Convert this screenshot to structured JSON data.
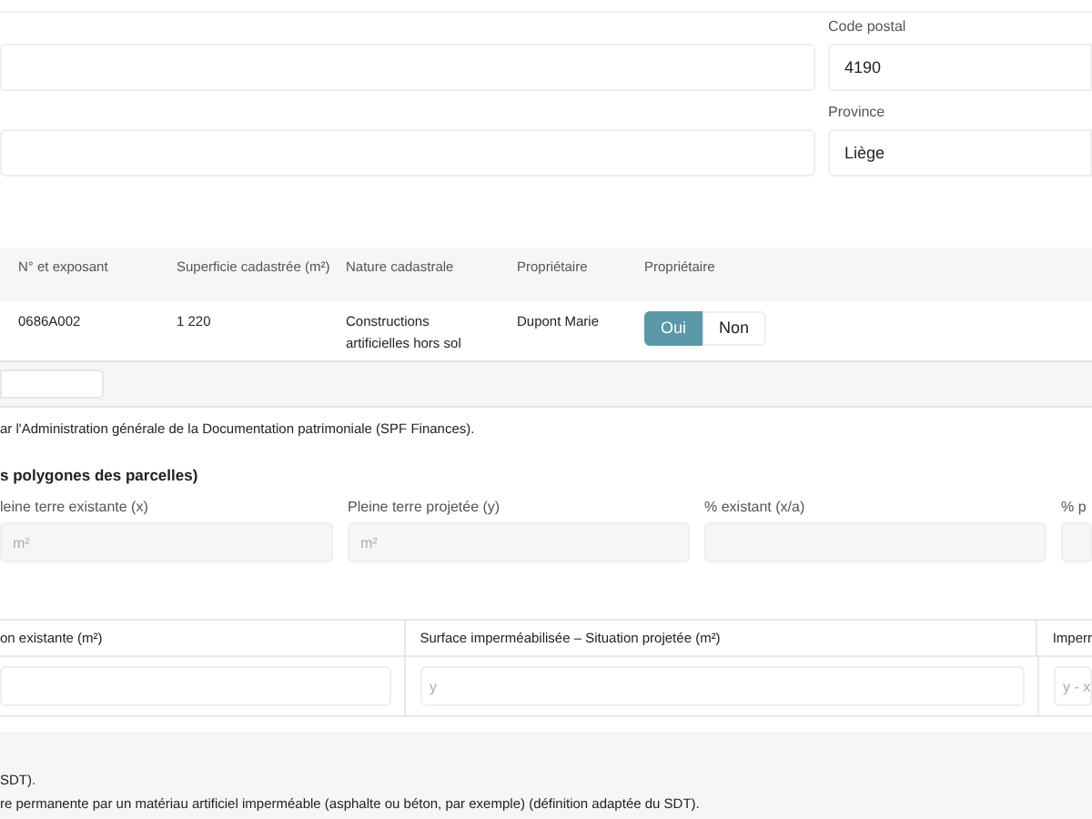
{
  "location_fields": [
    {
      "label": "Code postal",
      "value": "4190"
    },
    {
      "label": "Province",
      "value": "Liège"
    }
  ],
  "parcels_table": {
    "columns": [
      "N° et exposant",
      "Superficie cadastrée (m²)",
      "Nature cadastrale",
      "Propriétaire",
      "Propriétaire"
    ],
    "rows": [
      {
        "cells": [
          "0686A002",
          "1 220",
          "Constructions artificielles hors sol",
          "Dupont Marie"
        ],
        "owner_choice": [
          {
            "label": "Oui",
            "selected": true
          },
          {
            "label": "Non",
            "selected": false
          }
        ]
      }
    ]
  },
  "source_note": "ar l'Administration générale de la Documentation patrimoniale (SPF Finances).",
  "section_heading": "s polygones des parcelles)",
  "surface_fields": [
    {
      "label": "leine terre existante (x)",
      "placeholder": "m²"
    },
    {
      "label": "Pleine terre projetée (y)",
      "placeholder": "m²"
    },
    {
      "label": "% existant (x/a)"
    },
    {
      "label": "% p"
    }
  ],
  "impermeable_table": {
    "columns": [
      {
        "label": "on existante (m²)"
      },
      {
        "label": "Surface imperméabilisée – Situation projetée (m²)",
        "placeholder": "y"
      },
      {
        "label": "Imperr",
        "placeholder": "y - x"
      }
    ]
  },
  "footnotes": [
    "SDT).",
    "re permanente par un matériau artificiel imperméable (asphalte ou béton, par exemple) (définition adaptée du SDT)."
  ]
}
